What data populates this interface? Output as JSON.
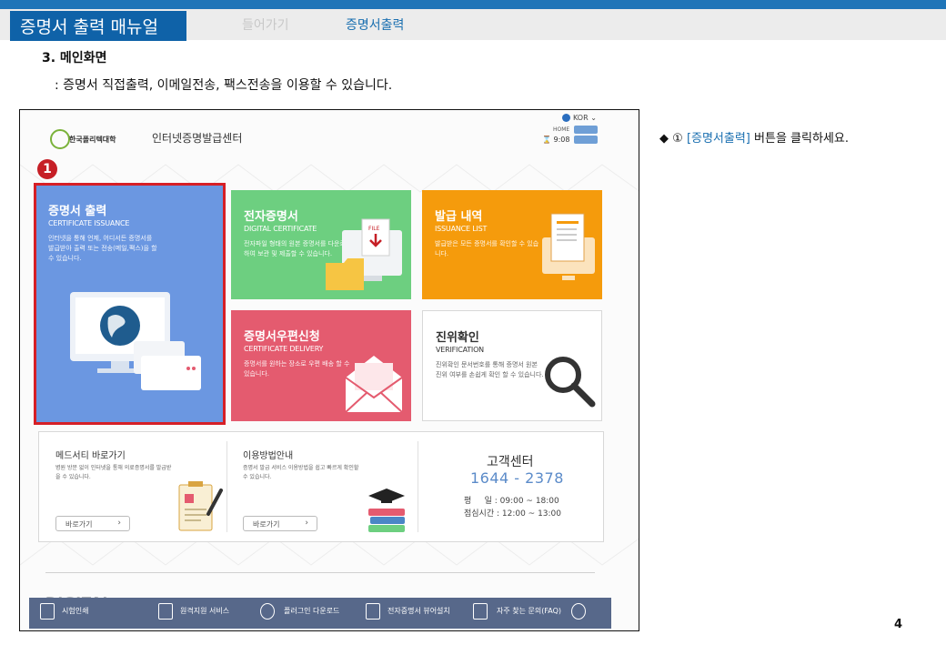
{
  "header": {
    "title": "증명서 출력 매뉴얼",
    "nav": [
      "들어가기",
      "증명서출력"
    ]
  },
  "section": {
    "title": "3. 메인화면",
    "desc": ": 증명서 직접출력, 이메일전송, 팩스전송을 이용할 수 있습니다."
  },
  "site": {
    "logo_text": "한국폴리텍대학",
    "center_name": "인터넷증명발급센터",
    "lang": "KOR",
    "home_label": "HOME",
    "clock": "9:08",
    "step_badge": "1"
  },
  "tiles": {
    "cert": {
      "title": "증명서 출력",
      "sub": "CERTIFICATE ISSUANCE",
      "desc": "인터넷을 통해 언제, 어디서든 증명서를 발급받아 출력 또는 전송(메일,팩스)을 할 수 있습니다."
    },
    "digital": {
      "title": "전자증명서",
      "sub": "DIGITAL CERTIFICATE",
      "desc": "전자파일 형태의 원본 증명서를 다운로드하여 보관 및 제출할 수 있습니다."
    },
    "history": {
      "title": "발급 내역",
      "sub": "ISSUANCE LIST",
      "desc": "발급받은 모든 증명서를 확인할 수 있습니다."
    },
    "post": {
      "title": "증명서우편신청",
      "sub": "CERTIFICATE DELIVERY",
      "desc": "증명서를 원하는 장소로 우편 배송 할 수 있습니다."
    },
    "verify": {
      "title": "진위확인",
      "sub": "VERIFICATION",
      "desc": "진위확인 문서번호를 통해 증명서 원본 진위 여부를 손쉽게 확인 할 수 있습니다."
    }
  },
  "bottom": {
    "medi": {
      "title": "메드서티 바로가기",
      "desc": "병원 방문 없이 인터넷을 통해 의료증명서를 발급받을 수 있습니다.",
      "button": "바로가기"
    },
    "guide": {
      "title": "이용방법안내",
      "desc": "증명서 발급 서비스 이용방법을 쉽고 빠르게 확인할 수 있습니다.",
      "button": "바로가기"
    },
    "cs": {
      "title": "고객센터",
      "phone": "1644 - 2378",
      "hours1": "평     일 : 09:00 ~ 18:00",
      "hours2": "점심시간 : 12:00 ~ 13:00"
    }
  },
  "footer": {
    "mark": "DIGITAL",
    "nav": [
      "시험인쇄",
      "원격지원 서비스",
      "플러그인 다운로드",
      "전자증명서 뷰어설치",
      "자주 찾는 문의(FAQ)"
    ]
  },
  "instruction": {
    "prefix": "◆ ①",
    "highlight": "[증명서출력]",
    "suffix": "버튼을  클릭하세요."
  },
  "page_number": "4"
}
